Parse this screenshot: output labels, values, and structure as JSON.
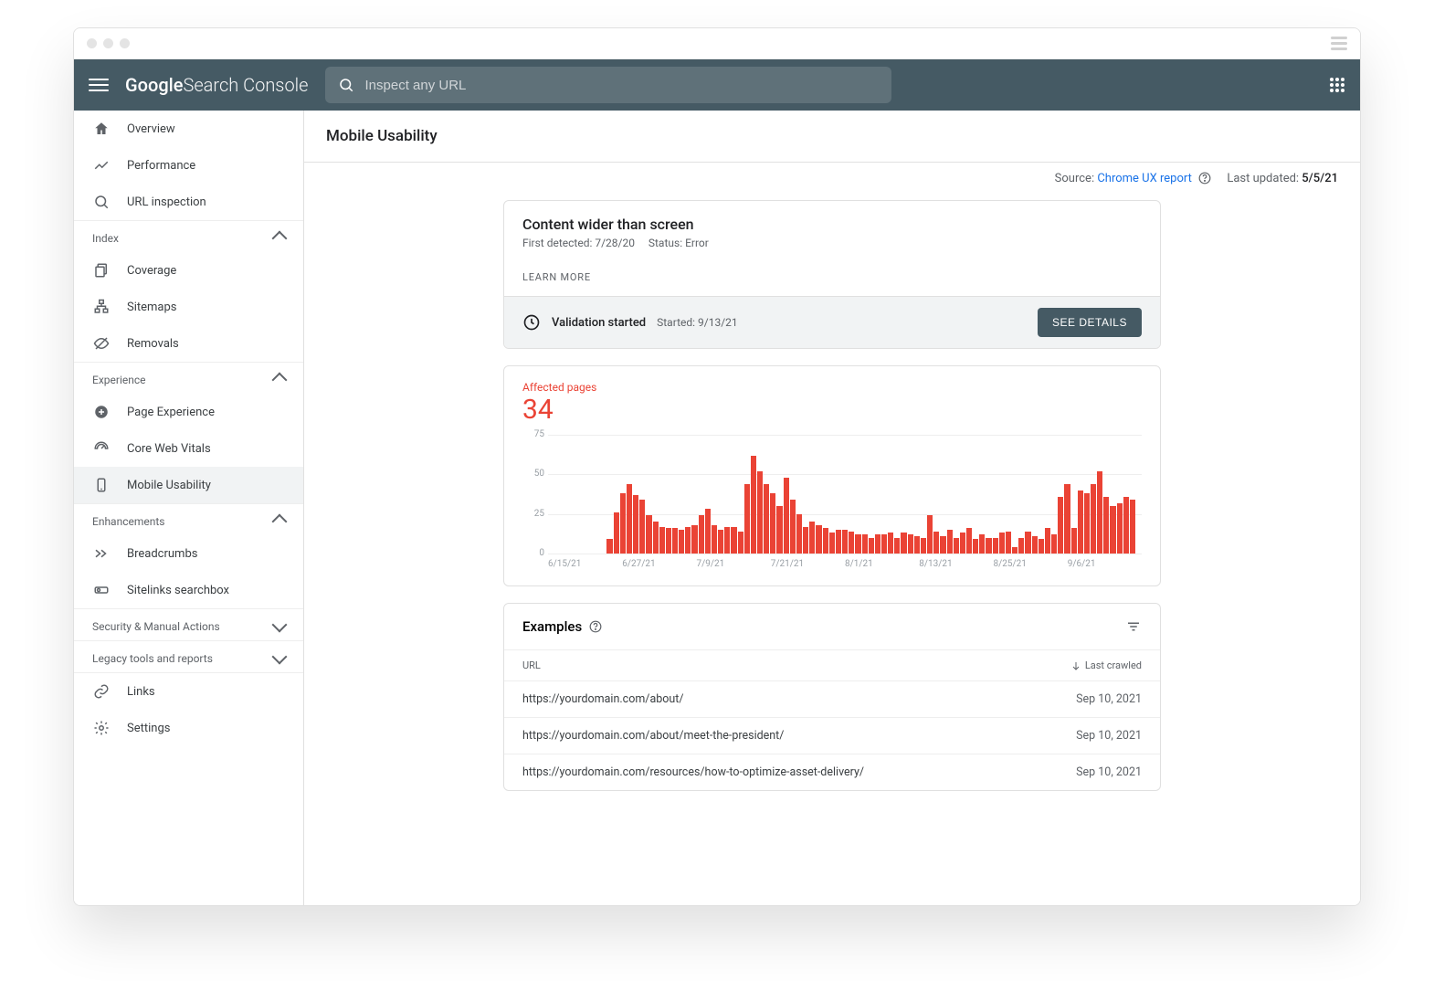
{
  "brand": {
    "g": "Google",
    "sc": " Search Console"
  },
  "search": {
    "placeholder": "Inspect any URL"
  },
  "sidebar": {
    "overview": "Overview",
    "performance": "Performance",
    "url_inspection": "URL inspection",
    "index_h": "Index",
    "coverage": "Coverage",
    "sitemaps": "Sitemaps",
    "removals": "Removals",
    "experience_h": "Experience",
    "page_experience": "Page Experience",
    "cwv": "Core Web Vitals",
    "mobile": "Mobile Usability",
    "enhancements_h": "Enhancements",
    "breadcrumbs": "Breadcrumbs",
    "sitelinks": "Sitelinks searchbox",
    "security_h": "Security & Manual Actions",
    "legacy_h": "Legacy tools and reports",
    "links": "Links",
    "settings": "Settings"
  },
  "page": {
    "title": "Mobile Usability",
    "source_label": "Source: ",
    "source_link": "Chrome UX report",
    "updated_label": "Last updated: ",
    "updated_value": "5/5/21"
  },
  "issue": {
    "title": "Content wider than screen",
    "detected_label": "First detected: ",
    "detected_value": "7/28/20",
    "status_label": "Status: ",
    "status_value": "Error",
    "learn": "LEARN MORE",
    "val_label": "Validation started",
    "val_started_label": "Started: ",
    "val_started_value": "9/13/21",
    "details_btn": "SEE DETAILS"
  },
  "affected": {
    "label": "Affected pages",
    "count": "34"
  },
  "examples": {
    "title": "Examples",
    "col_url": "URL",
    "col_crawled": "Last crawled",
    "rows": [
      {
        "url": "https://yourdomain.com/about/",
        "crawled": "Sep 10, 2021"
      },
      {
        "url": "https://yourdomain.com/about/meet-the-president/",
        "crawled": "Sep 10, 2021"
      },
      {
        "url": "https://yourdomain.com/resources/how-to-optimize-asset-delivery/",
        "crawled": "Sep 10, 2021"
      }
    ]
  },
  "chart_data": {
    "type": "bar",
    "title": "Affected pages",
    "ylabel": "",
    "xlabel": "",
    "ylim": [
      0,
      75
    ],
    "yticks": [
      0,
      25,
      50,
      75
    ],
    "xticks": [
      "6/15/21",
      "6/27/21",
      "7/9/21",
      "7/21/21",
      "8/1/21",
      "8/13/21",
      "8/25/21",
      "9/6/21"
    ],
    "categories": [
      "6/15",
      "6/16",
      "6/17",
      "6/18",
      "6/19",
      "6/20",
      "6/21",
      "6/22",
      "6/23",
      "6/24",
      "6/25",
      "6/26",
      "6/27",
      "6/28",
      "6/29",
      "6/30",
      "7/1",
      "7/2",
      "7/3",
      "7/4",
      "7/5",
      "7/6",
      "7/7",
      "7/8",
      "7/9",
      "7/10",
      "7/11",
      "7/12",
      "7/13",
      "7/14",
      "7/15",
      "7/16",
      "7/17",
      "7/18",
      "7/19",
      "7/20",
      "7/21",
      "7/22",
      "7/23",
      "7/24",
      "7/25",
      "7/26",
      "7/27",
      "7/28",
      "7/29",
      "7/30",
      "7/31",
      "8/1",
      "8/2",
      "8/3",
      "8/4",
      "8/5",
      "8/6",
      "8/7",
      "8/8",
      "8/9",
      "8/10",
      "8/11",
      "8/12",
      "8/13",
      "8/14",
      "8/15",
      "8/16",
      "8/17",
      "8/18",
      "8/19",
      "8/20",
      "8/21",
      "8/22",
      "8/23",
      "8/24",
      "8/25",
      "8/26",
      "8/27",
      "8/28",
      "8/29",
      "8/30",
      "8/31",
      "9/1",
      "9/2",
      "9/3",
      "9/4",
      "9/5",
      "9/6",
      "9/7",
      "9/8",
      "9/9",
      "9/10",
      "9/11",
      "9/12",
      "9/13"
    ],
    "values": [
      0,
      0,
      0,
      0,
      0,
      0,
      0,
      0,
      0,
      9,
      26,
      38,
      44,
      37,
      34,
      24,
      20,
      17,
      16,
      16,
      15,
      17,
      18,
      24,
      28,
      18,
      15,
      17,
      17,
      14,
      44,
      62,
      52,
      44,
      38,
      30,
      48,
      34,
      25,
      17,
      20,
      18,
      16,
      13,
      15,
      15,
      14,
      12,
      12,
      10,
      12,
      12,
      13,
      10,
      13,
      12,
      11,
      10,
      24,
      14,
      11,
      15,
      10,
      13,
      16,
      9,
      12,
      10,
      10,
      13,
      14,
      4,
      10,
      14,
      11,
      9,
      16,
      12,
      36,
      44,
      16,
      40,
      38,
      44,
      52,
      36,
      30,
      32,
      36,
      34,
      0
    ]
  }
}
